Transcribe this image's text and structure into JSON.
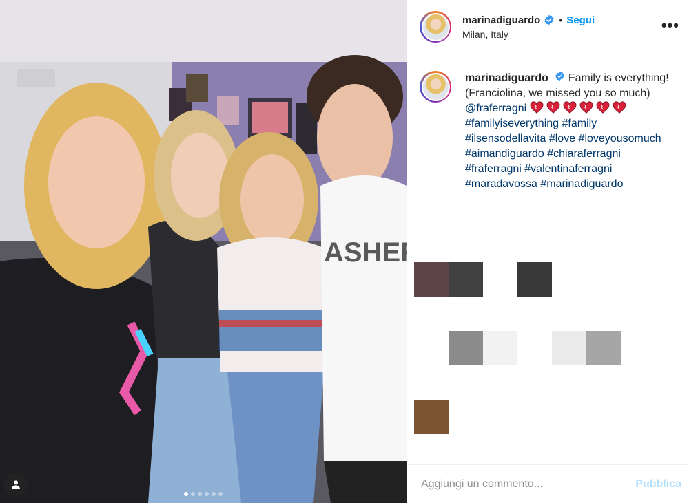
{
  "post": {
    "username": "marinadiguardo",
    "follow_label": "Segui",
    "separator": "•",
    "location": "Milan, Italy",
    "more_label": "•••"
  },
  "caption": {
    "username": "marinadiguardo",
    "text": "Family is everything!(Franciolina, we missed you so much)",
    "mention": "@fraferragni",
    "hashtags": "#familyiseverything #family #ilsensodellavita #love #loveyousomuch #aimandiguardo #chiaraferragni #fraferragni #valentinaferragni #maradavossa #marinadiguardo",
    "heart_count": 6
  },
  "carousel": {
    "total": 6,
    "active_index": 0
  },
  "comment": {
    "placeholder": "Aggiungi un commento...",
    "publish_label": "Pubblica"
  },
  "colors": {
    "accent": "#0095f6",
    "link": "#00376b",
    "publish_disabled": "#b2dffc",
    "placeholder_blocks": [
      "#5e4447",
      "#404040",
      "#383838",
      "#8c8c8c",
      "#f2f2f2",
      "#ebebeb",
      "#a6a6a6",
      "#7d5431"
    ]
  },
  "icons": [
    "verified-badge-icon",
    "more-options-icon",
    "user-tag-icon",
    "heart-emoji-icon"
  ]
}
